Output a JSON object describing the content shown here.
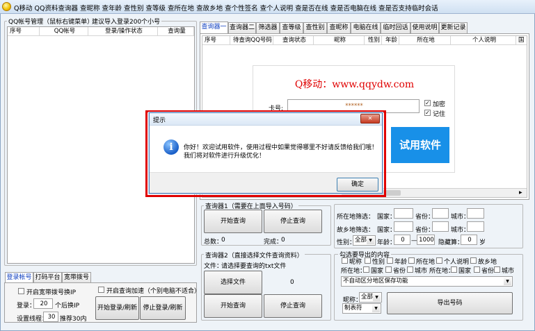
{
  "window": {
    "title": "Q移动 QQ资料查询器 查昵称 查年龄 查性别 查等级 查所在地 查故乡地 查个性签名 查个人说明 查是否在线 查是否电脑在线 查是否支持临时会话"
  },
  "left": {
    "group_title": "QQ帐号管理（鼠标右键菜单）",
    "group_hint": "建议导入登录200个小号",
    "columns": [
      "序号",
      "QQ帐号",
      "登录/操作状态",
      "查询量"
    ],
    "tabs": [
      "登录帐号",
      "打码平台",
      "宽带拨号"
    ],
    "cb_broadband": "开启宽带拨号换IP",
    "cb_accelerate": "开启查询加速（个别电脑不适合）",
    "login_label": "登录：",
    "login_value": "20",
    "login_suffix": "个后换IP",
    "threads_label": "设置线程：",
    "threads_value": "30",
    "threads_suffix": "推荐30内",
    "btn_login": "开始登录/刷新",
    "btn_stop_login": "停止登录/刷新"
  },
  "right": {
    "tabs": [
      "查询器一",
      "查询器二",
      "筛选器",
      "查等级",
      "查性别",
      "查昵称",
      "电脑在线",
      "临时回话",
      "使用说明",
      "更新记录"
    ],
    "columns": [
      "序号",
      "待查询QQ号码",
      "查询状态",
      "昵称",
      "性别",
      "年龄",
      "所在地",
      "个人说明",
      "国"
    ],
    "promo": {
      "title": "Q移动：www.qqydw.com",
      "card_label": "卡号:",
      "card_value": "******",
      "cb_encrypt": "加密",
      "cb_remember": "记住",
      "trial_button": "试用软件"
    },
    "query1": {
      "title": "查询器1（需要在上面导入号码）",
      "btn_start": "开始查询",
      "btn_stop": "停止查询",
      "total_label": "总数：",
      "total_value": "0",
      "done_label": "完成：",
      "done_value": "0"
    },
    "query2": {
      "title": "查询器2（直接选择文件查询资料）",
      "file_label": "文件：",
      "file_value": "请选择要查询的txt文件",
      "btn_select": "选择文件",
      "count_value": "0",
      "btn_start": "开始查询",
      "btn_stop": "停止查询"
    },
    "filter": {
      "loc_label": "所在地筛选：",
      "home_label": "故乡地筛选：",
      "country": "国家：",
      "province": "省份：",
      "city": "城市：",
      "gender_label": "性别：",
      "gender_value": "全部",
      "age_label": "年龄：",
      "age_from": "0",
      "dash": "—",
      "age_to": "1000",
      "hidden_label": "隐藏算：",
      "hidden_value": "0",
      "hidden_unit": "岁"
    },
    "export": {
      "title": "勾选要导出的内容",
      "row1": [
        "昵称",
        "性别",
        "年龄",
        "所在地",
        "个人说明",
        "故乡地"
      ],
      "row2_labels": [
        "所在地：",
        "国家",
        "省份",
        "城市",
        "所在地：",
        "国家",
        "省份",
        "城市"
      ],
      "save_mode": "不自动区分地区保存功能",
      "nick_label": "昵称：",
      "nick_value": "全部",
      "sep_value": "制表符",
      "btn_export": "导出号码"
    }
  },
  "dialog": {
    "title": "提示",
    "message_line1": "你好！欢迎试用软件，使用过程中如果觉得哪里不好请反馈给我们哦！",
    "message_line2": "我们将对软件进行升级优化！",
    "ok_button": "确定",
    "close_glyph": "✕",
    "highlight_color": "#e00000"
  }
}
